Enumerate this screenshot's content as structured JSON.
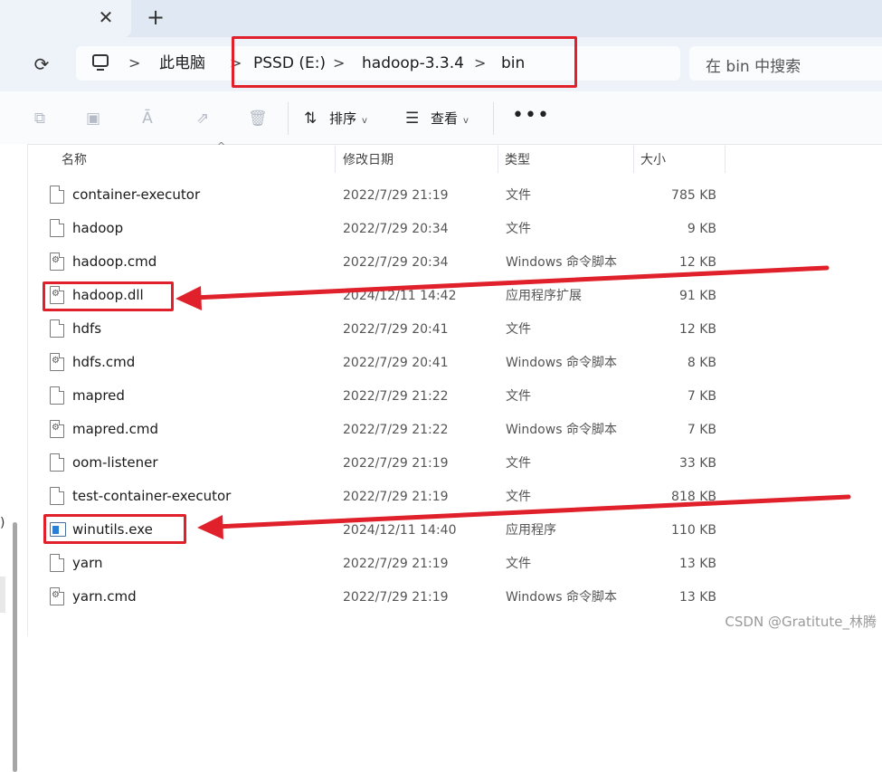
{
  "window": {
    "close_glyph": "✕",
    "new_tab_glyph": "+"
  },
  "address": {
    "refresh_glyph": "⟳",
    "breadcrumbs": [
      "此电脑",
      "PSSD (E:)",
      "hadoop-3.3.4",
      "bin"
    ],
    "separator": ">",
    "search_placeholder": "在 bin 中搜索"
  },
  "toolbar": {
    "sort_label": "排序",
    "view_label": "查看",
    "more_glyph": "•••",
    "icons": [
      "copy-icon",
      "paste-icon",
      "rename-icon",
      "share-icon",
      "delete-icon",
      "sort-icon",
      "view-icon",
      "more-icon"
    ]
  },
  "columns": {
    "name": "名称",
    "modified": "修改日期",
    "type": "类型",
    "size": "大小"
  },
  "files": [
    {
      "name": "container-executor",
      "modified": "2022/7/29 21:19",
      "type": "文件",
      "size": "785 KB",
      "icon": "file"
    },
    {
      "name": "hadoop",
      "modified": "2022/7/29 20:34",
      "type": "文件",
      "size": "9 KB",
      "icon": "file"
    },
    {
      "name": "hadoop.cmd",
      "modified": "2022/7/29 20:34",
      "type": "Windows 命令脚本",
      "size": "12 KB",
      "icon": "cmd"
    },
    {
      "name": "hadoop.dll",
      "modified": "2024/12/11 14:42",
      "type": "应用程序扩展",
      "size": "91 KB",
      "icon": "cmd"
    },
    {
      "name": "hdfs",
      "modified": "2022/7/29 20:41",
      "type": "文件",
      "size": "12 KB",
      "icon": "file"
    },
    {
      "name": "hdfs.cmd",
      "modified": "2022/7/29 20:41",
      "type": "Windows 命令脚本",
      "size": "8 KB",
      "icon": "cmd"
    },
    {
      "name": "mapred",
      "modified": "2022/7/29 21:22",
      "type": "文件",
      "size": "7 KB",
      "icon": "file"
    },
    {
      "name": "mapred.cmd",
      "modified": "2022/7/29 21:22",
      "type": "Windows 命令脚本",
      "size": "7 KB",
      "icon": "cmd"
    },
    {
      "name": "oom-listener",
      "modified": "2022/7/29 21:19",
      "type": "文件",
      "size": "33 KB",
      "icon": "file"
    },
    {
      "name": "test-container-executor",
      "modified": "2022/7/29 21:19",
      "type": "文件",
      "size": "818 KB",
      "icon": "file"
    },
    {
      "name": "winutils.exe",
      "modified": "2024/12/11 14:40",
      "type": "应用程序",
      "size": "110 KB",
      "icon": "exe"
    },
    {
      "name": "yarn",
      "modified": "2022/7/29 21:19",
      "type": "文件",
      "size": "13 KB",
      "icon": "file"
    },
    {
      "name": "yarn.cmd",
      "modified": "2022/7/29 21:19",
      "type": "Windows 命令脚本",
      "size": "13 KB",
      "icon": "cmd"
    }
  ],
  "sidebar": {
    "fragment": ")"
  },
  "annotation": {
    "color": "#e0202a"
  },
  "watermark": "CSDN @Gratitute_林腾"
}
